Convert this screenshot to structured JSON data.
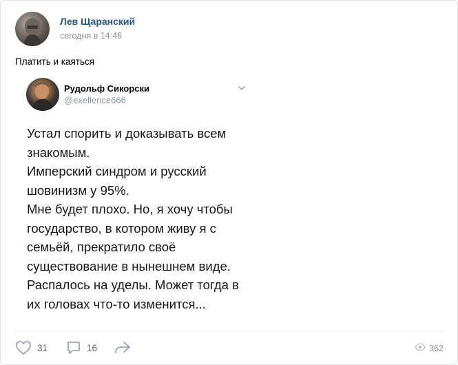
{
  "post": {
    "author": "Лев Щаранский",
    "time": "сегодня в 14:46",
    "text": "Платить и каяться"
  },
  "repost": {
    "author": "Рудольф Сикорски",
    "handle": "@exellence666",
    "lines": [
      "Устал спорить и доказывать всем",
      "знакомым.",
      "Имперский синдром и русский",
      "шовинизм у 95%.",
      "Мне будет плохо. Но, я хочу чтобы",
      "государство, в котором живу я с",
      "семьёй, прекратило своё",
      "существование в нынешнем виде.",
      "Распалось на уделы. Может тогда в",
      "их головах что-то изменится..."
    ]
  },
  "actions": {
    "likes": "31",
    "comments": "16",
    "views": "362"
  },
  "icons": {
    "like": "heart-icon",
    "comment": "comment-icon",
    "share": "share-arrow-icon",
    "views": "eye-icon",
    "menu": "chevron-down-icon"
  },
  "colors": {
    "author_link": "#2a5885",
    "meta_gray": "#939393",
    "icon_gray": "#99a2ad"
  }
}
